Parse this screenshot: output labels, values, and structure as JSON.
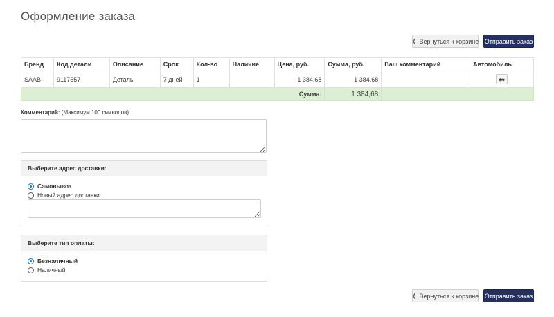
{
  "page": {
    "title": "Оформление заказа"
  },
  "actions": {
    "back_label": "Вернуться к корзине",
    "submit_label": "Отправить заказ"
  },
  "table": {
    "headers": [
      "Бренд",
      "Код детали",
      "Описание",
      "Срок",
      "Кол-во",
      "Наличие",
      "Цена, руб.",
      "Сумма, руб.",
      "Ваш комментарий",
      "Автомобиль"
    ],
    "rows": [
      {
        "brand": "SAAB",
        "code": "9117557",
        "description": "Деталь",
        "term": "7 дней",
        "qty": "1",
        "availability": "",
        "price": "1 384.68",
        "sum": "1 384.68",
        "comment": ""
      }
    ],
    "total_label": "Сумма:",
    "total_value": "1 384,68"
  },
  "comment": {
    "label": "Комментарий:",
    "hint": "(Максимум 100 символов)",
    "value": ""
  },
  "delivery": {
    "title": "Выберите адрес доставки:",
    "options": [
      {
        "label": "Самовывоз",
        "checked": true
      },
      {
        "label": "Новый адрес доставки:",
        "checked": false
      }
    ],
    "address_value": ""
  },
  "payment": {
    "title": "Выберите тип оплаты:",
    "options": [
      {
        "label": "Безналичный",
        "checked": true
      },
      {
        "label": "Наличный",
        "checked": false
      }
    ]
  },
  "icons": {
    "back": "chevron-left-icon",
    "car": "car-icon"
  },
  "colors": {
    "primary_button": "#263060",
    "total_row": "#dcefd5",
    "radio_checked": "#2b6cb0"
  }
}
